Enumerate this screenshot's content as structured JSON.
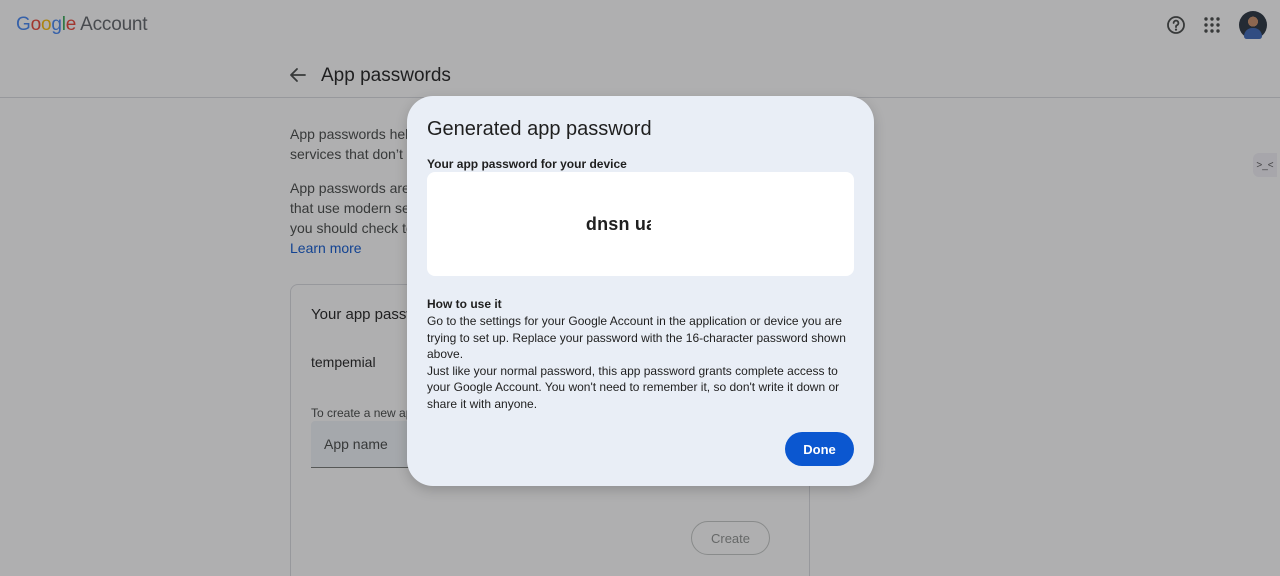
{
  "header": {
    "logo_google": [
      "G",
      "o",
      "o",
      "g",
      "l",
      "e"
    ],
    "logo_account": "Account",
    "icons": [
      "help-icon",
      "apps-grid-icon",
      "avatar"
    ]
  },
  "subheader": {
    "back_icon": "arrow-left-icon",
    "title": "App passwords"
  },
  "background": {
    "para1": "App passwords help\nservices that don’t",
    "para2": "App passwords are\nthat use modern se\nyou should check to",
    "learn_more": "Learn more",
    "card_title": "Your app passw",
    "app_item": "tempemial",
    "create_hint": "To create a new ap",
    "app_name_placeholder": "App name",
    "create_label": "Create"
  },
  "side_extension": {
    "icon": "extension-face-icon",
    "glyph": ">_<"
  },
  "dialog": {
    "title": "Generated app password",
    "subtitle": "Your app password for your device",
    "password": "dnsn uapd d",
    "how_title": "How to use it",
    "how_body_1": "Go to the settings for your Google Account in the application or device you are trying to set up. Replace your password with the 16-character password shown above.",
    "how_body_2": "Just like your normal password, this app password grants complete access to your Google Account. You won't need to remember it, so don't write it down or share it with anyone.",
    "done_label": "Done"
  },
  "colors": {
    "accent": "#0b57d0",
    "dialog_bg": "#e9eef6",
    "scrim": "rgba(32,33,36,0.36)"
  }
}
